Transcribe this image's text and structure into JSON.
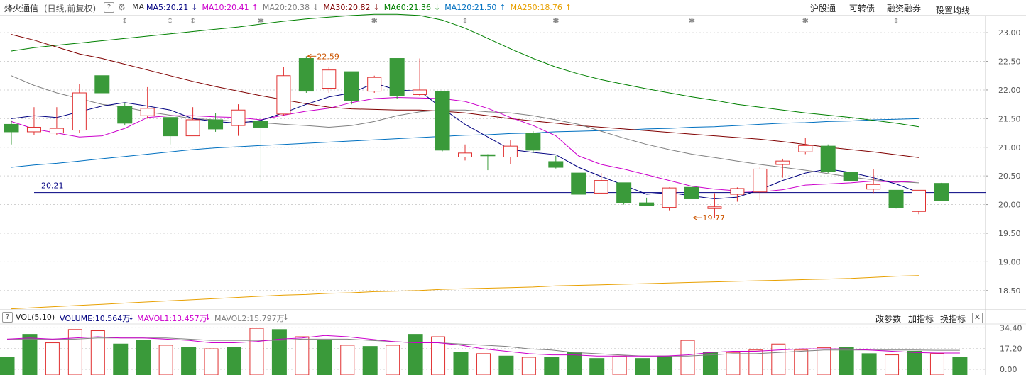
{
  "header": {
    "stock_name": "烽火通信",
    "period_label": "(日线,前复权)",
    "help_label": "?",
    "indicator_label": "MA",
    "ma_items": [
      {
        "text": "MA5:20.21",
        "arrow": "↓",
        "color": "#000080"
      },
      {
        "text": "MA10:20.41",
        "arrow": "↑",
        "color": "#cc00cc"
      },
      {
        "text": "MA20:20.38",
        "arrow": "↓",
        "color": "#808080"
      },
      {
        "text": "MA30:20.82",
        "arrow": "↓",
        "color": "#800000"
      },
      {
        "text": "MA60:21.36",
        "arrow": "↓",
        "color": "#008000"
      },
      {
        "text": "MA120:21.50",
        "arrow": "↑",
        "color": "#0070c0"
      },
      {
        "text": "MA250:18.76",
        "arrow": "↑",
        "color": "#e8a000"
      }
    ],
    "right_buttons": [
      "沪股通",
      "可转债",
      "融资融券",
      "设置均线"
    ],
    "dropdown_glyph": "▾"
  },
  "volume_header": {
    "help_label": "?",
    "title": "VOL(5,10)",
    "volume_label": "VOLUME:10.564万",
    "volume_arrow": "↓",
    "mavol1_label": "MAVOL1:13.457万",
    "mavol1_arrow": "↓",
    "mavol2_label": "MAVOL2:15.797万",
    "mavol2_arrow": "↓",
    "right_buttons": [
      "改参数",
      "加指标",
      "换指标"
    ],
    "close_glyph": "✕"
  },
  "colors": {
    "up": "#e03030",
    "down": "#3a9a3a",
    "grid": "#d0d0d0",
    "ma5": "#000080",
    "ma10": "#cc00cc",
    "ma20": "#808080",
    "ma30": "#800000",
    "ma60": "#008000",
    "ma120": "#0070c0",
    "ma250": "#e8a000",
    "ref_line": "#000080",
    "annotation": "#cc5500"
  },
  "chart_data": [
    {
      "type": "candlestick",
      "ylim": [
        18.2,
        23.2
      ],
      "yticks": [
        "23.00",
        "22.50",
        "22.00",
        "21.50",
        "21.00",
        "20.50",
        "20.00",
        "19.50",
        "19.00",
        "18.50"
      ],
      "grid": true,
      "reference_line": {
        "value": 20.21,
        "label": "20.21"
      },
      "annotations": [
        {
          "index": 13,
          "value": 22.59,
          "text": "22.59"
        },
        {
          "index": 30,
          "value": 19.77,
          "text": "19.77"
        }
      ],
      "event_markers": [
        {
          "index": 5,
          "glyph": "↕"
        },
        {
          "index": 7,
          "glyph": "↕"
        },
        {
          "index": 8,
          "glyph": "↕"
        },
        {
          "index": 11,
          "glyph": "✱"
        },
        {
          "index": 16,
          "glyph": "✱"
        },
        {
          "index": 20,
          "glyph": "↕"
        },
        {
          "index": 24,
          "glyph": "✱"
        },
        {
          "index": 30,
          "glyph": "✱"
        },
        {
          "index": 35,
          "glyph": "✱"
        },
        {
          "index": 39,
          "glyph": "↕"
        }
      ],
      "candles": [
        {
          "o": 21.4,
          "h": 21.47,
          "l": 21.05,
          "c": 21.27
        },
        {
          "o": 21.27,
          "h": 21.7,
          "l": 21.22,
          "c": 21.35
        },
        {
          "o": 21.25,
          "h": 21.7,
          "l": 21.22,
          "c": 21.33
        },
        {
          "o": 21.3,
          "h": 22.1,
          "l": 21.25,
          "c": 21.95
        },
        {
          "o": 22.25,
          "h": 22.25,
          "l": 21.95,
          "c": 21.95
        },
        {
          "o": 21.72,
          "h": 21.78,
          "l": 21.38,
          "c": 21.42
        },
        {
          "o": 21.55,
          "h": 22.05,
          "l": 21.5,
          "c": 21.68
        },
        {
          "o": 21.52,
          "h": 21.52,
          "l": 21.05,
          "c": 21.2
        },
        {
          "o": 21.2,
          "h": 21.7,
          "l": 21.2,
          "c": 21.48
        },
        {
          "o": 21.48,
          "h": 21.6,
          "l": 21.27,
          "c": 21.32
        },
        {
          "o": 21.38,
          "h": 21.75,
          "l": 21.2,
          "c": 21.65
        },
        {
          "o": 21.45,
          "h": 21.6,
          "l": 20.4,
          "c": 21.35
        },
        {
          "o": 21.58,
          "h": 22.4,
          "l": 21.55,
          "c": 22.25
        },
        {
          "o": 22.55,
          "h": 22.59,
          "l": 21.95,
          "c": 21.98
        },
        {
          "o": 22.03,
          "h": 22.4,
          "l": 21.95,
          "c": 22.35
        },
        {
          "o": 22.32,
          "h": 22.32,
          "l": 21.75,
          "c": 21.82
        },
        {
          "o": 21.98,
          "h": 22.25,
          "l": 21.95,
          "c": 22.22
        },
        {
          "o": 22.55,
          "h": 22.55,
          "l": 21.85,
          "c": 21.9
        },
        {
          "o": 21.92,
          "h": 22.55,
          "l": 21.9,
          "c": 22.0
        },
        {
          "o": 21.98,
          "h": 21.98,
          "l": 20.93,
          "c": 20.95
        },
        {
          "o": 20.83,
          "h": 21.05,
          "l": 20.77,
          "c": 20.9
        },
        {
          "o": 20.87,
          "h": 20.88,
          "l": 20.6,
          "c": 20.86
        },
        {
          "o": 20.83,
          "h": 21.12,
          "l": 20.7,
          "c": 21.02
        },
        {
          "o": 21.25,
          "h": 21.28,
          "l": 20.9,
          "c": 20.95
        },
        {
          "o": 20.75,
          "h": 20.85,
          "l": 20.63,
          "c": 20.65
        },
        {
          "o": 20.55,
          "h": 20.55,
          "l": 20.18,
          "c": 20.18
        },
        {
          "o": 20.2,
          "h": 20.55,
          "l": 20.18,
          "c": 20.42
        },
        {
          "o": 20.38,
          "h": 20.38,
          "l": 20.0,
          "c": 20.03
        },
        {
          "o": 20.03,
          "h": 20.12,
          "l": 19.98,
          "c": 19.98
        },
        {
          "o": 19.95,
          "h": 20.3,
          "l": 19.9,
          "c": 20.29
        },
        {
          "o": 20.3,
          "h": 20.67,
          "l": 19.77,
          "c": 20.1
        },
        {
          "o": 19.93,
          "h": 20.2,
          "l": 19.77,
          "c": 19.96
        },
        {
          "o": 20.18,
          "h": 20.3,
          "l": 20.05,
          "c": 20.28
        },
        {
          "o": 20.22,
          "h": 20.65,
          "l": 20.08,
          "c": 20.62
        },
        {
          "o": 20.7,
          "h": 20.8,
          "l": 20.47,
          "c": 20.76
        },
        {
          "o": 20.92,
          "h": 21.17,
          "l": 20.88,
          "c": 21.03
        },
        {
          "o": 21.02,
          "h": 21.05,
          "l": 20.55,
          "c": 20.58
        },
        {
          "o": 20.57,
          "h": 20.57,
          "l": 20.42,
          "c": 20.42
        },
        {
          "o": 20.27,
          "h": 20.62,
          "l": 20.2,
          "c": 20.35
        },
        {
          "o": 20.25,
          "h": 20.25,
          "l": 19.93,
          "c": 19.95
        },
        {
          "o": 19.88,
          "h": 20.25,
          "l": 19.83,
          "c": 20.25
        },
        {
          "o": 20.37,
          "h": 20.38,
          "l": 20.07,
          "c": 20.07
        }
      ],
      "ma": {
        "ma5": [
          21.5,
          21.55,
          21.52,
          21.62,
          21.72,
          21.78,
          21.72,
          21.65,
          21.5,
          21.45,
          21.42,
          21.47,
          21.6,
          21.75,
          21.88,
          21.95,
          22.12,
          22.0,
          21.98,
          21.68,
          21.4,
          21.18,
          20.96,
          20.91,
          20.87,
          20.65,
          20.49,
          20.34,
          20.18,
          20.21,
          20.15,
          20.1,
          20.13,
          20.26,
          20.42,
          20.55,
          20.62,
          20.56,
          20.47,
          20.36,
          20.21
        ],
        "ma10": [
          21.45,
          21.32,
          21.25,
          21.18,
          21.2,
          21.33,
          21.52,
          21.55,
          21.55,
          21.53,
          21.52,
          21.48,
          21.56,
          21.63,
          21.68,
          21.78,
          21.85,
          21.87,
          21.86,
          21.85,
          21.8,
          21.68,
          21.52,
          21.38,
          21.2,
          20.85,
          20.7,
          20.62,
          20.52,
          20.42,
          20.32,
          20.27,
          20.24,
          20.22,
          20.26,
          20.34,
          20.36,
          20.38,
          20.41,
          20.39,
          20.41
        ],
        "ma20": [
          22.25,
          22.08,
          21.95,
          21.85,
          21.75,
          21.7,
          21.62,
          21.56,
          21.5,
          21.48,
          21.45,
          21.43,
          21.4,
          21.38,
          21.35,
          21.38,
          21.45,
          21.55,
          21.62,
          21.65,
          21.65,
          21.62,
          21.6,
          21.55,
          21.48,
          21.4,
          21.28,
          21.16,
          21.05,
          20.96,
          20.88,
          20.82,
          20.76,
          20.7,
          20.65,
          20.6,
          20.54,
          20.48,
          20.43,
          20.4,
          20.38
        ],
        "ma30": [
          22.97,
          22.87,
          22.75,
          22.63,
          22.55,
          22.45,
          22.35,
          22.25,
          22.15,
          22.06,
          21.98,
          21.9,
          21.83,
          21.76,
          21.7,
          21.67,
          21.66,
          21.65,
          21.65,
          21.63,
          21.6,
          21.55,
          21.5,
          21.46,
          21.42,
          21.38,
          21.35,
          21.32,
          21.29,
          21.26,
          21.23,
          21.2,
          21.17,
          21.14,
          21.1,
          21.05,
          21.0,
          20.96,
          20.92,
          20.87,
          20.82
        ],
        "ma60": [
          22.68,
          22.74,
          22.78,
          22.82,
          22.86,
          22.9,
          22.94,
          22.98,
          23.02,
          23.06,
          23.1,
          23.15,
          23.2,
          23.24,
          23.27,
          23.3,
          23.32,
          23.32,
          23.3,
          23.22,
          23.08,
          22.9,
          22.72,
          22.55,
          22.4,
          22.28,
          22.18,
          22.1,
          22.02,
          21.95,
          21.88,
          21.82,
          21.75,
          21.7,
          21.65,
          21.6,
          21.56,
          21.52,
          21.47,
          21.42,
          21.36
        ],
        "ma120": [
          20.65,
          20.69,
          20.72,
          20.76,
          20.8,
          20.84,
          20.88,
          20.92,
          20.96,
          20.99,
          21.01,
          21.03,
          21.05,
          21.07,
          21.09,
          21.11,
          21.13,
          21.15,
          21.17,
          21.19,
          21.21,
          21.22,
          21.24,
          21.25,
          21.27,
          21.28,
          21.29,
          21.3,
          21.32,
          21.33,
          21.35,
          21.36,
          21.38,
          21.4,
          21.42,
          21.43,
          21.45,
          21.46,
          21.48,
          21.49,
          21.5
        ],
        "ma250": [
          18.18,
          18.2,
          18.22,
          18.24,
          18.26,
          18.28,
          18.3,
          18.32,
          18.34,
          18.36,
          18.38,
          18.4,
          18.42,
          18.43,
          18.45,
          18.46,
          18.48,
          18.49,
          18.5,
          18.52,
          18.53,
          18.54,
          18.55,
          18.56,
          18.58,
          18.59,
          18.6,
          18.61,
          18.62,
          18.63,
          18.64,
          18.65,
          18.66,
          18.67,
          18.68,
          18.69,
          18.7,
          18.71,
          18.73,
          18.75,
          18.76
        ]
      }
    },
    {
      "type": "bar",
      "title": "VOL(5,10)",
      "ylim": [
        0,
        37
      ],
      "yticks": [
        "34.40",
        "17.20",
        "0.00"
      ],
      "grid": true,
      "volume": [
        10,
        29,
        22,
        33,
        32,
        21,
        24,
        20,
        18,
        17,
        18,
        34,
        33,
        27,
        24,
        20,
        19,
        20,
        29,
        27,
        14,
        13,
        11,
        10,
        10,
        14,
        9,
        11,
        9,
        11,
        24,
        14,
        14,
        16,
        21,
        16,
        18,
        18,
        13,
        12,
        15,
        13,
        10
      ],
      "mavol1": [
        25,
        26,
        25,
        26,
        27,
        26,
        26,
        25,
        24,
        22,
        22,
        23,
        25,
        26,
        28,
        27,
        25,
        23,
        22,
        22,
        20,
        17,
        15,
        13,
        12,
        12,
        11,
        11,
        11,
        11,
        12,
        14,
        15,
        15,
        16,
        17,
        17,
        17,
        16,
        15,
        14,
        13.5,
        13.5
      ],
      "mavol2": [
        25,
        25,
        25,
        25,
        26,
        26,
        26,
        26,
        25,
        24,
        24,
        24,
        24,
        25,
        25,
        25,
        24,
        23,
        22,
        22,
        21,
        20,
        19,
        17,
        16,
        14,
        13,
        12,
        11,
        11,
        11,
        12,
        13,
        13,
        14,
        15,
        16,
        16,
        16,
        16,
        16,
        15.8,
        15.8
      ]
    }
  ]
}
